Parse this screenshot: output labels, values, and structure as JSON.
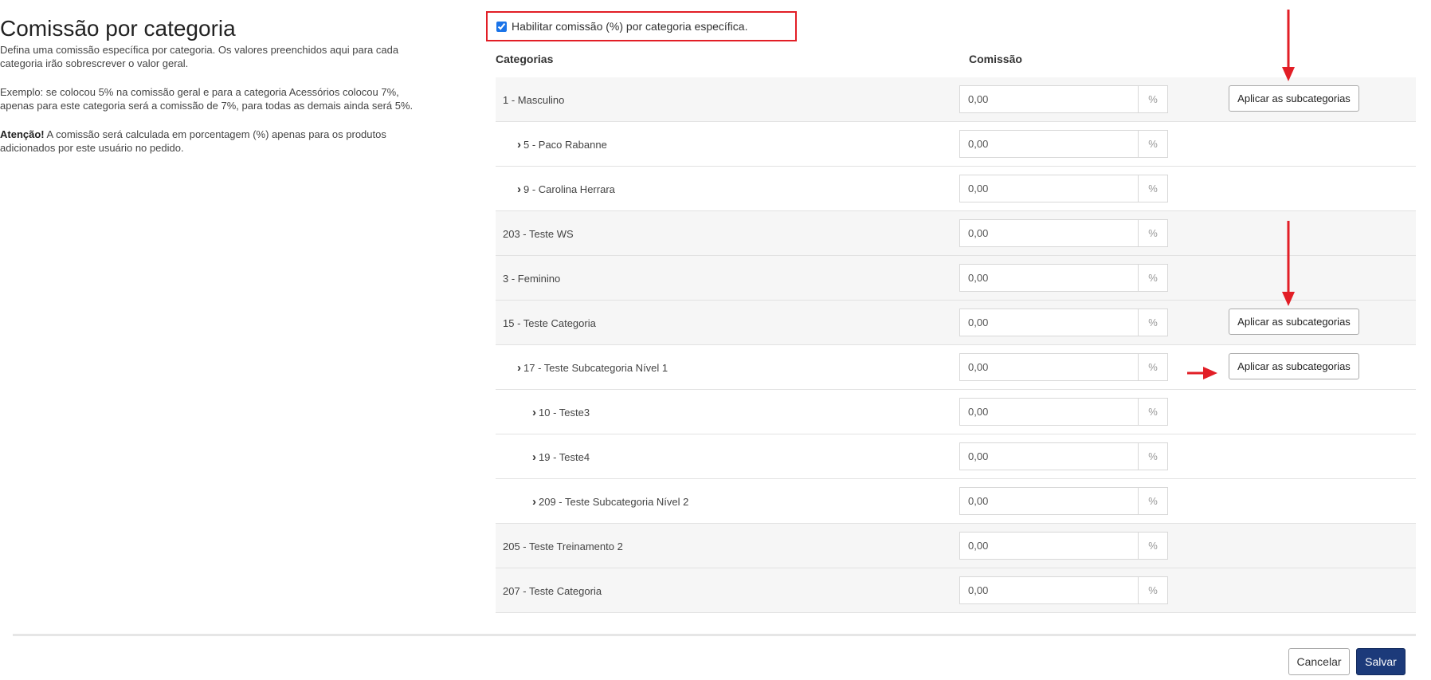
{
  "left": {
    "title": "Comissão por categoria",
    "description": "Defina uma comissão específica por categoria. Os valores preenchidos aqui para cada categoria irão sobrescrever o valor geral.",
    "example": "Exemplo: se colocou 5% na comissão geral e para a categoria Acessórios colocou 7%, apenas para este categoria será a comissão de 7%, para todas as demais ainda será 5%.",
    "warning_strong": "Atenção!",
    "warning_text": " A comissão será calculada em porcentagem (%) apenas para os produtos adicionados por este usuário no pedido."
  },
  "enable": {
    "label": "Habilitar comissão (%) por categoria específica.",
    "checked": true
  },
  "table": {
    "header_categories": "Categorias",
    "header_commission": "Comissão",
    "unit": "%",
    "apply_label": "Aplicar as subcategorias",
    "rows": [
      {
        "label": "1 - Masculino",
        "value": "0,00"
      },
      {
        "label": "5 - Paco Rabanne",
        "value": "0,00"
      },
      {
        "label": "9 - Carolina Herrara",
        "value": "0,00"
      },
      {
        "label": "203 - Teste WS",
        "value": "0,00"
      },
      {
        "label": "3 - Feminino",
        "value": "0,00"
      },
      {
        "label": "15 - Teste Categoria",
        "value": "0,00"
      },
      {
        "label": "17 - Teste Subcategoria Nível 1",
        "value": "0,00"
      },
      {
        "label": "10 - Teste3",
        "value": "0,00"
      },
      {
        "label": "19 - Teste4",
        "value": "0,00"
      },
      {
        "label": "209 - Teste Subcategoria Nível 2",
        "value": "0,00"
      },
      {
        "label": "205 - Teste Treinamento 2",
        "value": "0,00"
      },
      {
        "label": "207 - Teste Categoria",
        "value": "0,00"
      }
    ]
  },
  "footer": {
    "cancel_label": "Cancelar",
    "save_label": "Salvar"
  },
  "colors": {
    "annotation": "#e21e26",
    "save_bg": "#1c3a7a"
  }
}
